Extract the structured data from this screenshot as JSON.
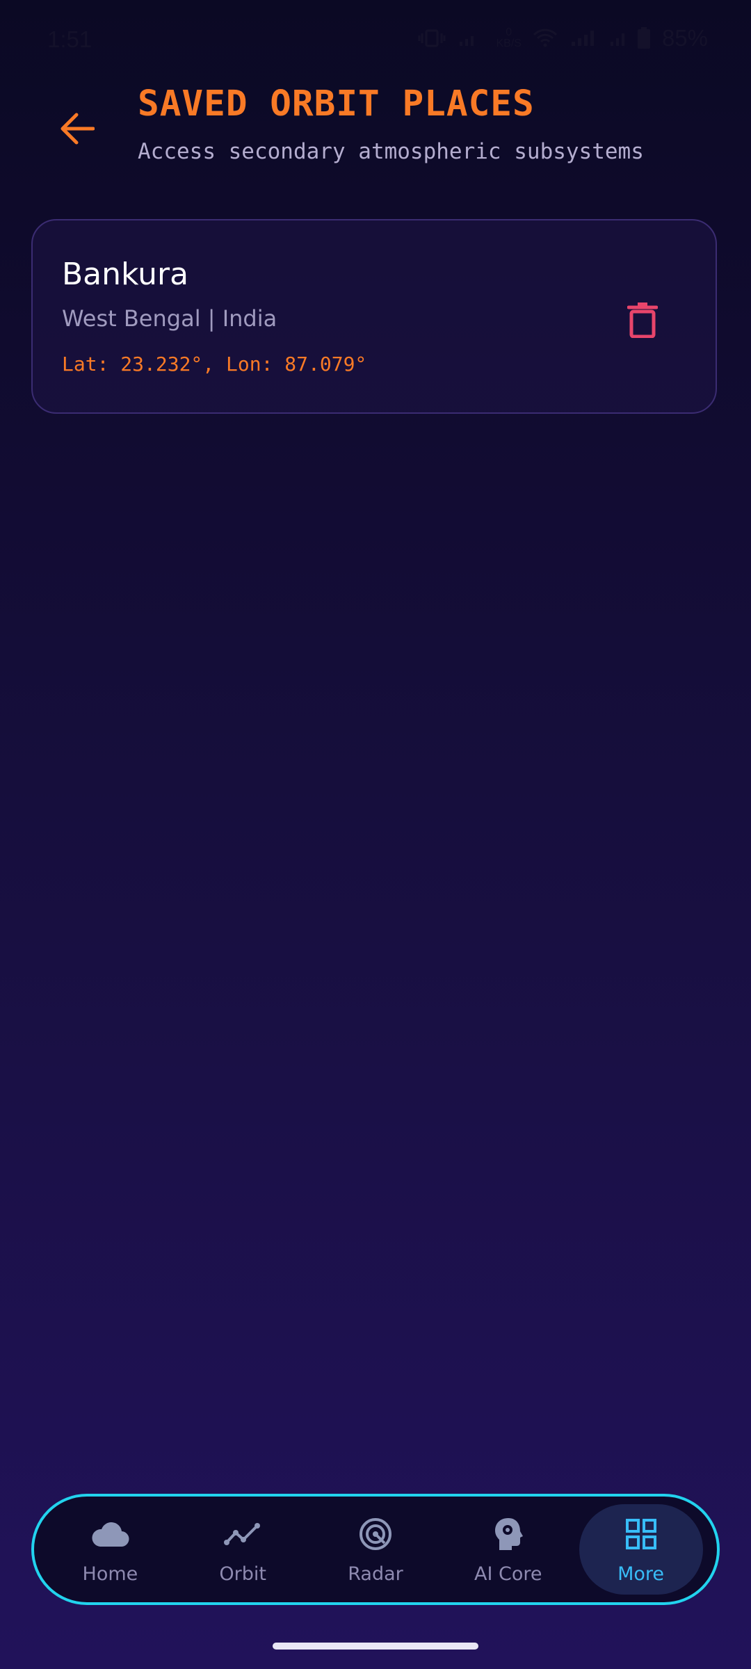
{
  "status_bar": {
    "time": "1:51",
    "network_speed_top": "0",
    "network_speed_unit": "KB/S",
    "battery": "85%"
  },
  "header": {
    "title": "SAVED ORBIT PLACES",
    "subtitle": "Access secondary atmospheric subsystems"
  },
  "places": [
    {
      "name": "Bankura",
      "region": "West Bengal | India",
      "coords": "Lat: 23.232°, Lon: 87.079°"
    }
  ],
  "nav": {
    "items": [
      {
        "label": "Home",
        "icon": "cloud-icon"
      },
      {
        "label": "Orbit",
        "icon": "trend-line-icon"
      },
      {
        "label": "Radar",
        "icon": "radar-icon"
      },
      {
        "label": "AI Core",
        "icon": "brain-gear-icon"
      },
      {
        "label": "More",
        "icon": "grid-icon",
        "active": true
      }
    ]
  },
  "colors": {
    "accent_orange": "#f97a26",
    "accent_cyan": "#22d3ee",
    "active_blue": "#38bdf8",
    "delete_red": "#e8456b"
  }
}
